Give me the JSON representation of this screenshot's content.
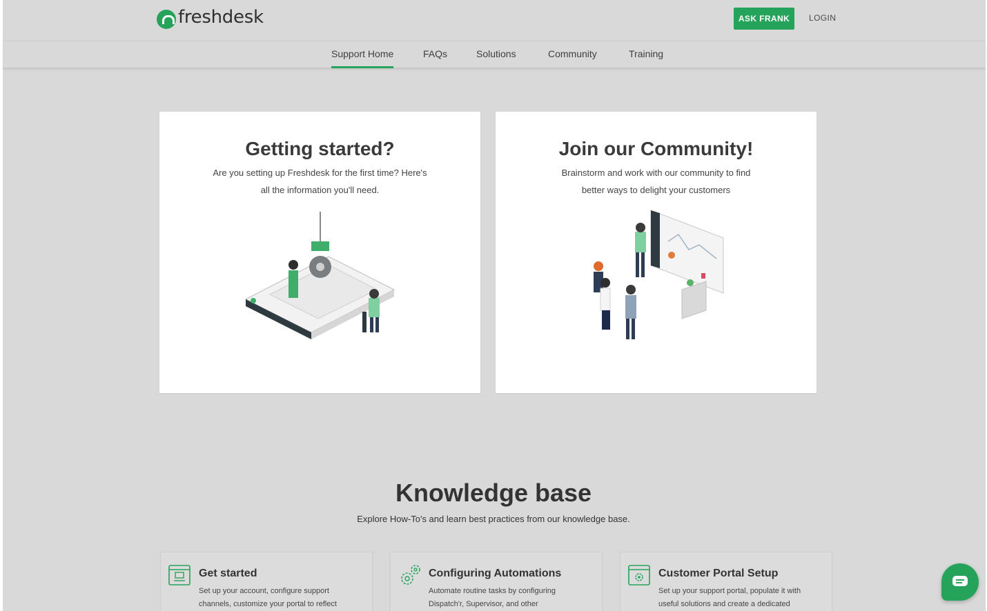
{
  "brand": {
    "name": "freshdesk",
    "accent": "#25a35a"
  },
  "header": {
    "ask_label": "ASK FRANK",
    "login_label": "LOGIN"
  },
  "nav": {
    "items": [
      {
        "label": "Support Home",
        "active": true
      },
      {
        "label": "FAQs"
      },
      {
        "label": "Solutions"
      },
      {
        "label": "Community"
      },
      {
        "label": "Training"
      }
    ]
  },
  "hero": {
    "cards": [
      {
        "title": "Getting started?",
        "line1": "Are you setting up Freshdesk for the first time? Here's",
        "line2": "all the information you'll need."
      },
      {
        "title": "Join our Community!",
        "line1": "Brainstorm and work with our community to find",
        "line2": "better ways to delight your customers"
      }
    ]
  },
  "knowledge_base": {
    "title": "Knowledge base",
    "subtitle": "Explore How-To's and learn best practices from our knowledge base.",
    "items": [
      {
        "title": "Get started",
        "line1": "Set up your account, configure support",
        "line2": "channels, customize your portal to reflect",
        "icon": "window-icon"
      },
      {
        "title": "Configuring Automations",
        "line1": "Automate routine tasks by configuring",
        "line2": "Dispatch'r, Supervisor, and other",
        "icon": "gears-icon"
      },
      {
        "title": "Customer Portal Setup",
        "line1": "Set up your support portal, populate it with",
        "line2": "useful solutions and create a dedicated",
        "icon": "portal-settings-icon"
      }
    ]
  },
  "chat": {
    "icon": "chat-bubble-icon"
  }
}
